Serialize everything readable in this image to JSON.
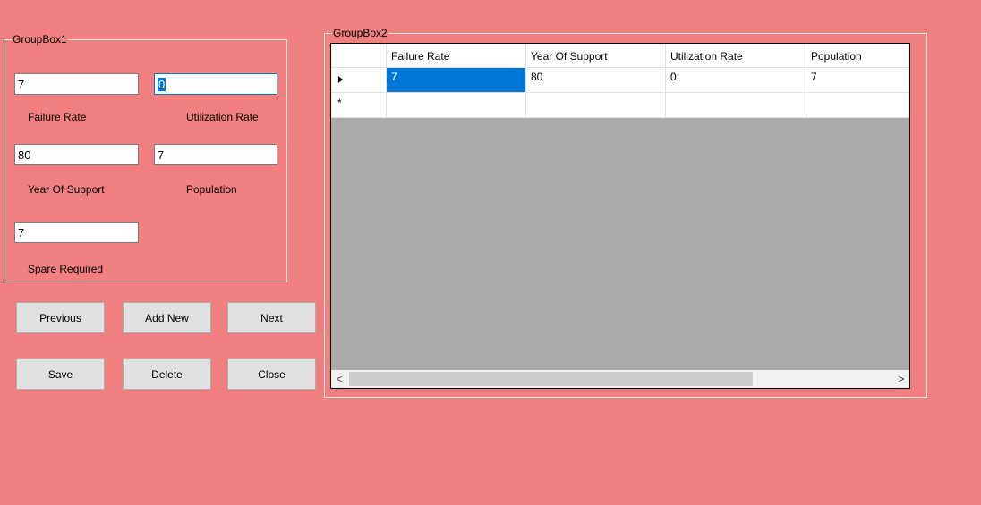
{
  "groupbox1": {
    "title": "GroupBox1",
    "fields": {
      "failure_rate": {
        "value": "7",
        "label": "Failure Rate"
      },
      "utilization_rate": {
        "value": "0",
        "label": "Utilization Rate"
      },
      "year_of_support": {
        "value": "80",
        "label": "Year Of Support"
      },
      "population": {
        "value": "7",
        "label": "Population"
      },
      "spare_required": {
        "value": "7",
        "label": "Spare Required"
      }
    }
  },
  "buttons": {
    "previous": "Previous",
    "add_new": "Add New",
    "next": "Next",
    "save": "Save",
    "delete": "Delete",
    "close": "Close"
  },
  "groupbox2": {
    "title": "GroupBox2"
  },
  "grid": {
    "columns": [
      "Failure Rate",
      "Year Of Support",
      "Utilization Rate",
      "Population"
    ],
    "rows": [
      [
        "7",
        "80",
        "0",
        "7"
      ]
    ],
    "new_row_marker": "*",
    "current_row_marker": "current-row-arrow-icon"
  },
  "scrollbar": {
    "left_arrow": "<",
    "right_arrow": ">"
  },
  "colors": {
    "background": "#F08080",
    "selection": "#0078D7",
    "grid_background": "#ABABAB"
  }
}
